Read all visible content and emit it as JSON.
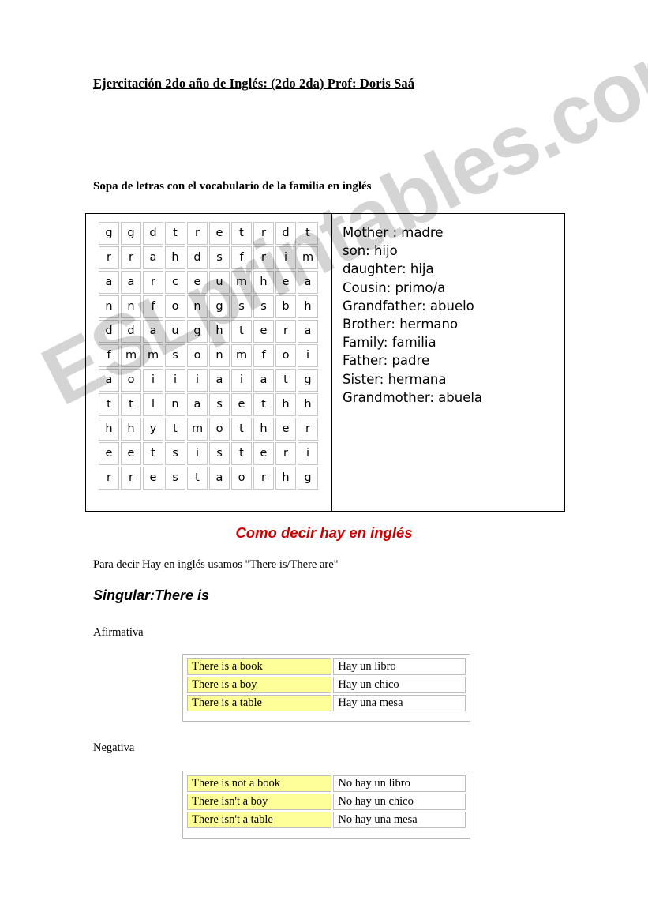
{
  "document": {
    "title": "Ejercitación 2do año de Inglés: (2do 2da)  Prof: Doris Saá",
    "section_heading": "Sopa de letras con el vocabulario de la familia en inglés"
  },
  "word_search": {
    "rows": [
      [
        "g",
        "g",
        "d",
        "t",
        "r",
        "e",
        "t",
        "r",
        "d",
        "t"
      ],
      [
        "r",
        "r",
        "a",
        "h",
        "d",
        "s",
        "f",
        "r",
        "i",
        "m"
      ],
      [
        "a",
        "a",
        "r",
        "c",
        "e",
        "u",
        "m",
        "h",
        "e",
        "a"
      ],
      [
        "n",
        "n",
        "f",
        "o",
        "n",
        "g",
        "s",
        "s",
        "b",
        "h"
      ],
      [
        "d",
        "d",
        "a",
        "u",
        "g",
        "h",
        "t",
        "e",
        "r",
        "a"
      ],
      [
        "f",
        "m",
        "m",
        "s",
        "o",
        "n",
        "m",
        "f",
        "o",
        "i"
      ],
      [
        "a",
        "o",
        "i",
        "i",
        "i",
        "a",
        "i",
        "a",
        "t",
        "g"
      ],
      [
        "t",
        "t",
        "l",
        "n",
        "a",
        "s",
        "e",
        "t",
        "h",
        "h"
      ],
      [
        "h",
        "h",
        "y",
        "t",
        "m",
        "o",
        "t",
        "h",
        "e",
        "r"
      ],
      [
        "e",
        "e",
        "t",
        "s",
        "i",
        "s",
        "t",
        "e",
        "r",
        "i"
      ],
      [
        "r",
        "r",
        "e",
        "s",
        "t",
        "a",
        "o",
        "r",
        "h",
        "g"
      ]
    ],
    "vocabulary": [
      "Mother : madre",
      "son: hijo",
      "daughter: hija",
      "Cousin: primo/a",
      "Grandfather: abuelo",
      "Brother: hermano",
      "Family: familia",
      "Father: padre",
      "Sister: hermana",
      "Grandmother: abuela"
    ]
  },
  "there_is_section": {
    "red_heading": "Como decir hay en inglés",
    "red_heading_color": "#cc0000",
    "intro": "Para decir Hay en inglés usamos \"There is/There are\"",
    "subheading": "Singular:There is",
    "affirmative": {
      "label": "Afirmativa",
      "rows": [
        {
          "en": "There is a book",
          "es": "Hay un libro"
        },
        {
          "en": "There is a boy",
          "es": "Hay un chico"
        },
        {
          "en": "There is a table",
          "es": "Hay una mesa"
        }
      ]
    },
    "negative": {
      "label": "Negativa",
      "rows": [
        {
          "en": "There is not a book",
          "es": "No hay un libro"
        },
        {
          "en": "There isn't a boy",
          "es": "No hay un chico"
        },
        {
          "en": "There isn't a table",
          "es": "No hay una mesa"
        }
      ]
    },
    "highlight_color": "#ffff99"
  },
  "watermark": {
    "text": "ESLprintables.com"
  }
}
